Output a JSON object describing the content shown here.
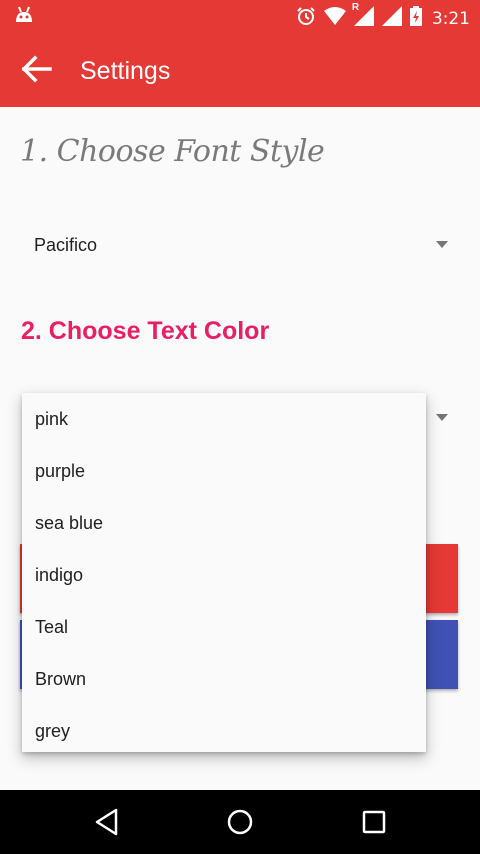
{
  "status_bar": {
    "time": "3:21",
    "icons": [
      "android-icon",
      "alarm-icon",
      "wifi-icon",
      "signal-roaming-icon",
      "signal-icon",
      "battery-charging-icon"
    ],
    "roaming_label": "R"
  },
  "app_bar": {
    "title": "Settings",
    "back_icon": "arrow-back-icon",
    "color": "#e53935"
  },
  "section1": {
    "heading": "1. Choose Font Style",
    "font_dropdown": {
      "selected": "Pacifico"
    }
  },
  "section2": {
    "heading": "2. Choose Text Color",
    "heading_color": "#e91e63",
    "color_options": [
      "pink",
      "purple",
      "sea blue",
      "indigo",
      "Teal",
      "Brown",
      "grey"
    ]
  },
  "buttons": {
    "red_color": "#e53935",
    "blue_color": "#3f51b5"
  },
  "nav_bar": {
    "icons": [
      "back-triangle-icon",
      "home-circle-icon",
      "recents-square-icon"
    ]
  }
}
